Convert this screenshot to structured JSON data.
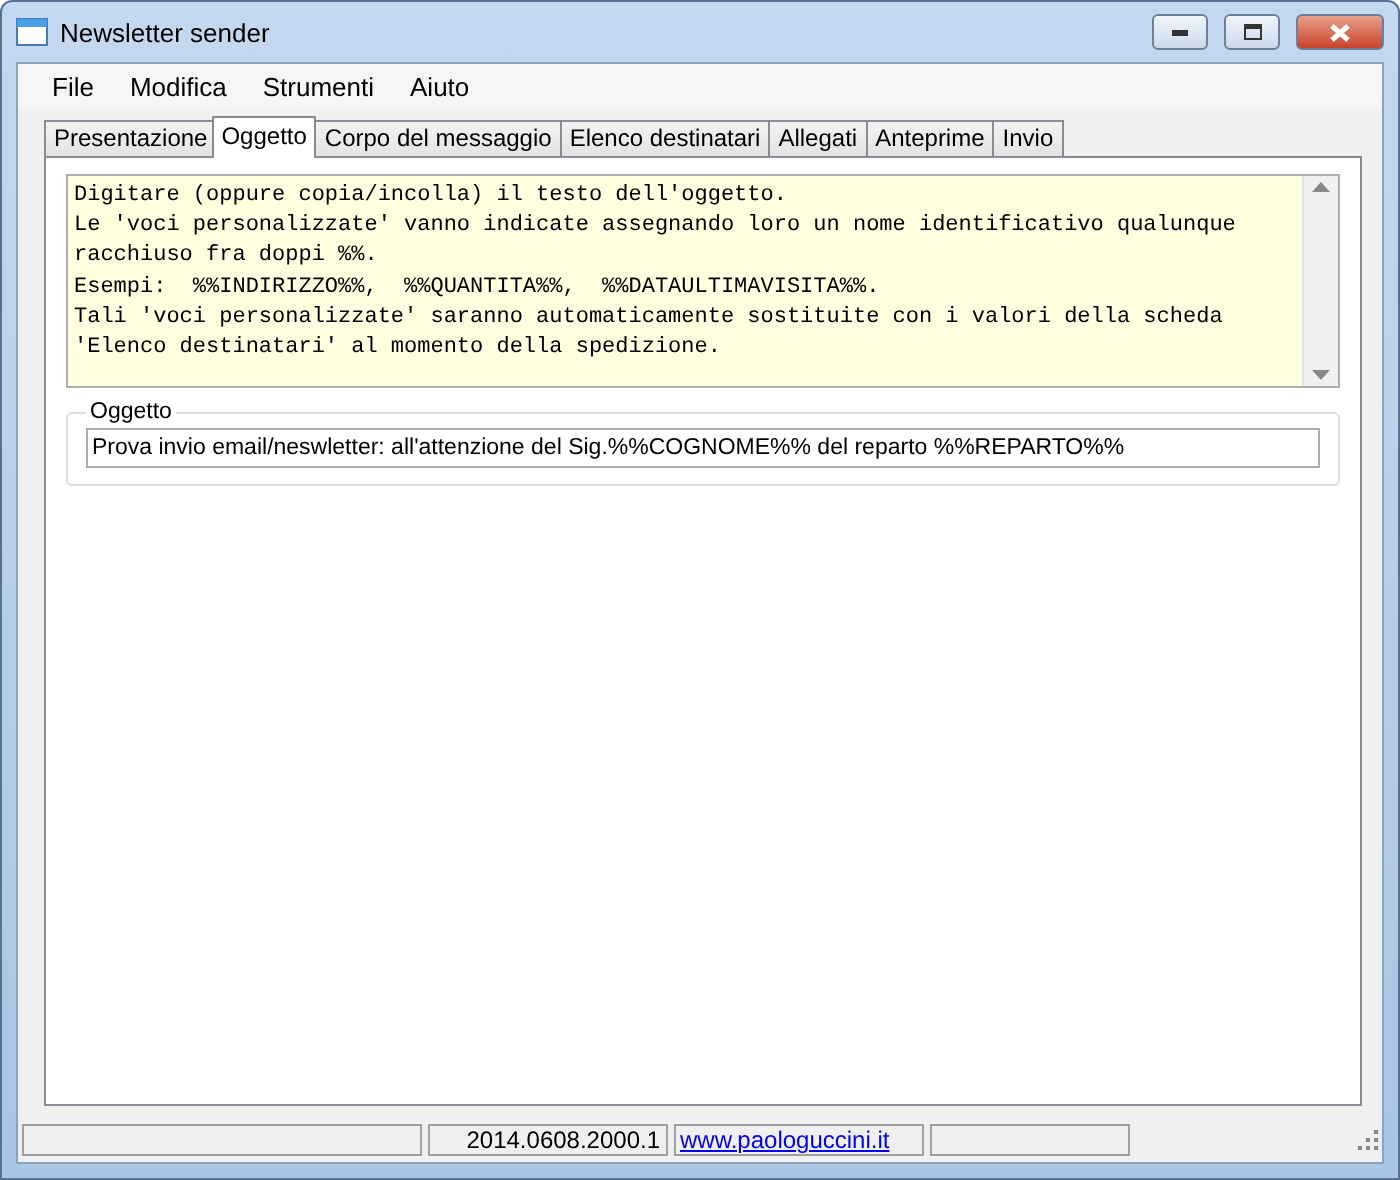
{
  "window": {
    "title": "Newsletter sender"
  },
  "menu": [
    "File",
    "Modifica",
    "Strumenti",
    "Aiuto"
  ],
  "tabs": [
    {
      "label": "Presentazione",
      "selected": false
    },
    {
      "label": "Oggetto",
      "selected": true
    },
    {
      "label": "Corpo del messaggio",
      "selected": false
    },
    {
      "label": "Elenco destinatari",
      "selected": false
    },
    {
      "label": "Allegati",
      "selected": false
    },
    {
      "label": "Anteprime",
      "selected": false
    },
    {
      "label": "Invio",
      "selected": false
    }
  ],
  "instructions": [
    "Digitare (oppure copia/incolla) il testo dell'oggetto.",
    "Le 'voci personalizzate' vanno indicate assegnando loro un nome identificativo qualunque",
    "racchiuso fra doppi %%.",
    "Esempi:  %%INDIRIZZO%%,  %%QUANTITA%%,  %%DATAULTIMAVISITA%%.",
    "Tali 'voci personalizzate' saranno automaticamente sostituite con i valori della scheda",
    "'Elenco destinatari' al momento della spedizione."
  ],
  "subject_group": {
    "label": "Oggetto",
    "value": "Prova invio email/neswletter: all'attenzione del Sig.%%COGNOME%% del reparto %%REPARTO%%"
  },
  "status_bar": [
    {
      "kind": "blank"
    },
    {
      "kind": "text",
      "text": "2014.0608.2000.1"
    },
    {
      "kind": "link",
      "text": "www.paologuccini.it"
    },
    {
      "kind": "blank"
    }
  ]
}
